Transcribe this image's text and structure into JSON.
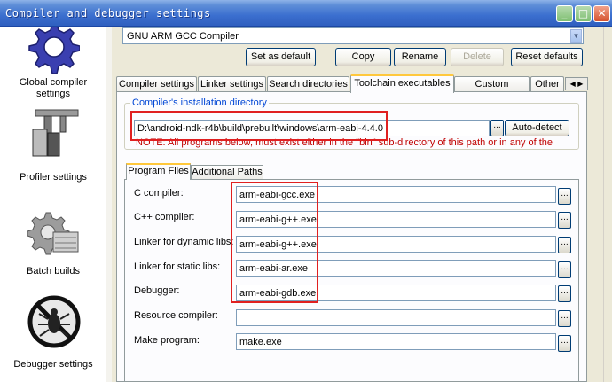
{
  "window": {
    "title": "Compiler and debugger settings",
    "controls": {
      "minimize": "_",
      "maximize": "□",
      "close": "✕"
    }
  },
  "sidebar": {
    "items": [
      {
        "label": "Global compiler settings",
        "icon": "gear-icon"
      },
      {
        "label": "Profiler settings",
        "icon": "caliper-icon"
      },
      {
        "label": "Batch builds",
        "icon": "batch-gear-icon"
      },
      {
        "label": "Debugger settings",
        "icon": "bug-icon"
      }
    ]
  },
  "compiler_select": {
    "value": "GNU ARM GCC Compiler",
    "arrow": "▼"
  },
  "buttons": {
    "set_default": "Set as default",
    "copy": "Copy",
    "rename": "Rename",
    "delete": "Delete",
    "reset_defaults": "Reset defaults",
    "auto_detect": "Auto-detect",
    "browse": "..."
  },
  "tabs": [
    "Compiler settings",
    "Linker settings",
    "Search directories",
    "Toolchain executables",
    "Custom variables",
    "Other"
  ],
  "tab_scroll": "◀ ▶",
  "install_dir": {
    "group_title": "Compiler's installation directory",
    "value": "D:\\android-ndk-r4b\\build\\prebuilt\\windows\\arm-eabi-4.4.0",
    "note": "NOTE: All programs below, must exist either in the \"bin\" sub-directory of this path or in any of the"
  },
  "subtabs": [
    "Program Files",
    "Additional Paths"
  ],
  "programs": [
    {
      "label": "C compiler:",
      "value": "arm-eabi-gcc.exe"
    },
    {
      "label": "C++ compiler:",
      "value": "arm-eabi-g++.exe"
    },
    {
      "label": "Linker for dynamic libs:",
      "value": "arm-eabi-g++.exe"
    },
    {
      "label": "Linker for static libs:",
      "value": "arm-eabi-ar.exe"
    },
    {
      "label": "Debugger:",
      "value": "arm-eabi-gdb.exe"
    },
    {
      "label": "Resource compiler:",
      "value": ""
    },
    {
      "label": "Make program:",
      "value": "make.exe"
    }
  ],
  "colors": {
    "highlight_box": "#e02020",
    "note_text": "#c00000",
    "group_title": "#0046d5",
    "active_tab_accent": "#ffc83c"
  }
}
